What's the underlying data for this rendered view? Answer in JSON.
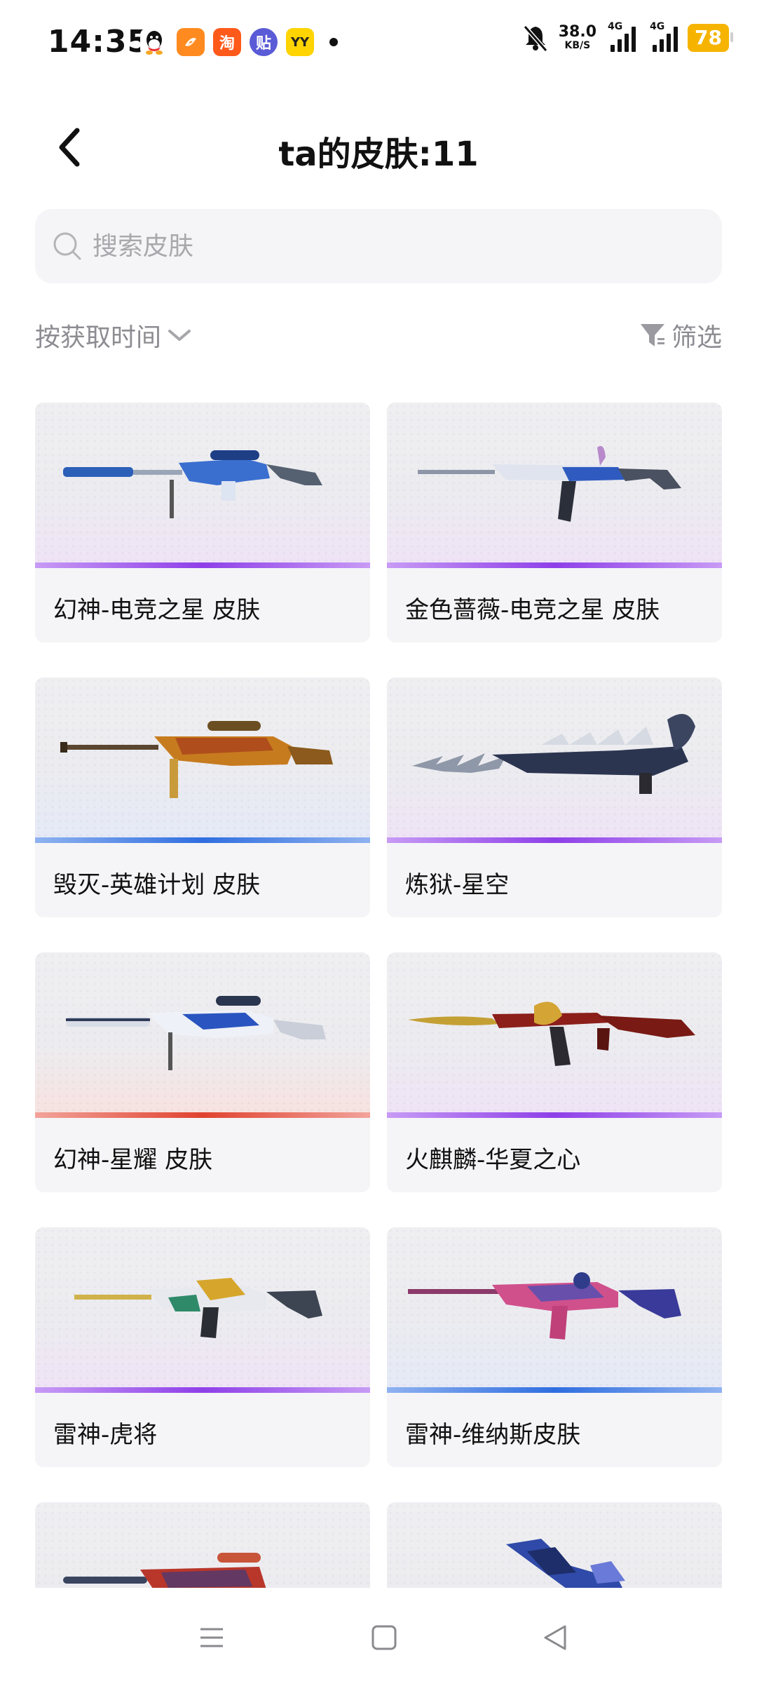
{
  "status_bar": {
    "time": "14:35",
    "apps": [
      "qq-icon",
      "orange-app-icon",
      "taobao-icon",
      "tieba-icon",
      "yy-icon"
    ],
    "app_labels": {
      "taobao": "淘",
      "tieba": "贴",
      "yy": "YY"
    },
    "net_speed": "38.0",
    "net_unit": "KB/S",
    "signal1": "4G",
    "signal2": "4G",
    "battery": "78",
    "colors": {
      "battery": "#f6b400"
    }
  },
  "header": {
    "title": "ta的皮肤:11",
    "back_icon": "chevron-left-icon"
  },
  "search": {
    "placeholder": "搜索皮肤",
    "value": ""
  },
  "sort": {
    "label": "按获取时间",
    "icon": "chevron-down-icon"
  },
  "filter": {
    "label": "筛选",
    "icon": "filter-icon"
  },
  "skins": [
    {
      "name": "幻神-电竞之星 皮肤",
      "rarity_color": "#9b59f0"
    },
    {
      "name": "金色蔷薇-电竞之星 皮肤",
      "rarity_color": "#9b59f0"
    },
    {
      "name": "毁灭-英雄计划 皮肤",
      "rarity_color": "#4a7fe0"
    },
    {
      "name": "炼狱-星空",
      "rarity_color": "#9b59f0"
    },
    {
      "name": "幻神-星耀 皮肤",
      "rarity_color": "#e8544a"
    },
    {
      "name": "火麒麟-华夏之心",
      "rarity_color": "#9b59f0"
    },
    {
      "name": "雷神-虎将",
      "rarity_color": "#9b59f0"
    },
    {
      "name": "雷神-维纳斯皮肤",
      "rarity_color": "#4a7fe0"
    },
    {
      "name": "",
      "rarity_color": "#9b59f0"
    },
    {
      "name": "",
      "rarity_color": "#9b59f0"
    }
  ],
  "nav": {
    "menu_icon": "menu-icon",
    "home_icon": "home-square-icon",
    "back_icon": "back-triangle-icon"
  }
}
